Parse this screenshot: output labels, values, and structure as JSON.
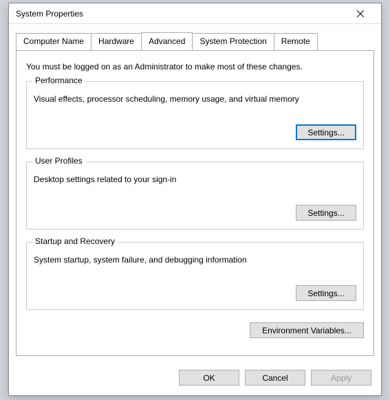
{
  "window": {
    "title": "System Properties"
  },
  "tabs": {
    "computer_name": "Computer Name",
    "hardware": "Hardware",
    "advanced": "Advanced",
    "system_protection": "System Protection",
    "remote": "Remote"
  },
  "intro": "You must be logged on as an Administrator to make most of these changes.",
  "performance": {
    "legend": "Performance",
    "desc": "Visual effects, processor scheduling, memory usage, and virtual memory",
    "settings_label": "Settings..."
  },
  "user_profiles": {
    "legend": "User Profiles",
    "desc": "Desktop settings related to your sign-in",
    "settings_label": "Settings..."
  },
  "startup_recovery": {
    "legend": "Startup and Recovery",
    "desc": "System startup, system failure, and debugging information",
    "settings_label": "Settings..."
  },
  "env_button": "Environment Variables...",
  "buttons": {
    "ok": "OK",
    "cancel": "Cancel",
    "apply": "Apply"
  }
}
